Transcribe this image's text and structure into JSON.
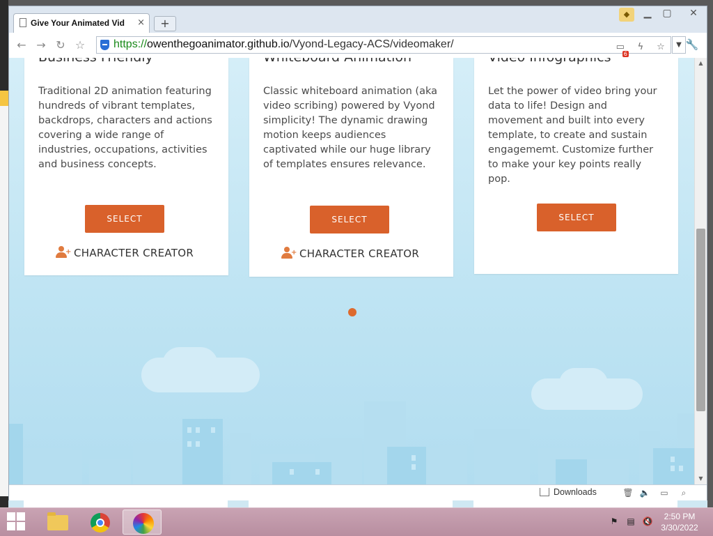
{
  "browser": {
    "tab_title": "Give Your Animated Vid",
    "tab_close": "×",
    "new_tab": "+",
    "url_scheme": "https://",
    "url_host": "owenthegoanimator.github.io",
    "url_path": "/Vyond-Legacy-ACS/videomaker/",
    "extension_badge": "6",
    "status_downloads": "Downloads"
  },
  "cards": [
    {
      "heading": "Business Friendly",
      "description": "Traditional 2D animation featuring hundreds of vibrant templates, backdrops, characters and actions covering a wide range of industries, occupations, activities and business concepts.",
      "select_label": "SELECT",
      "character_creator_label": "CHARACTER CREATOR"
    },
    {
      "heading": "Whiteboard Animation",
      "description": "Classic whiteboard animation (aka video scribing) powered by Vyond simplicity! The dynamic drawing motion keeps audiences captivated while our huge library of templates ensures relevance.",
      "select_label": "SELECT",
      "character_creator_label": "CHARACTER CREATOR"
    },
    {
      "heading": "Video Infographics",
      "description": "Let the power of video bring your data to life! Design and movement and built into every template, to create and sustain engagememt. Customize further to make your key points really pop.",
      "select_label": "SELECT"
    }
  ],
  "taskbar": {
    "time": "2:50 PM",
    "date": "3/30/2022"
  },
  "colors": {
    "accent": "#d9612b",
    "sky": "#c5e7f5",
    "taskbar": "#c09aab"
  }
}
